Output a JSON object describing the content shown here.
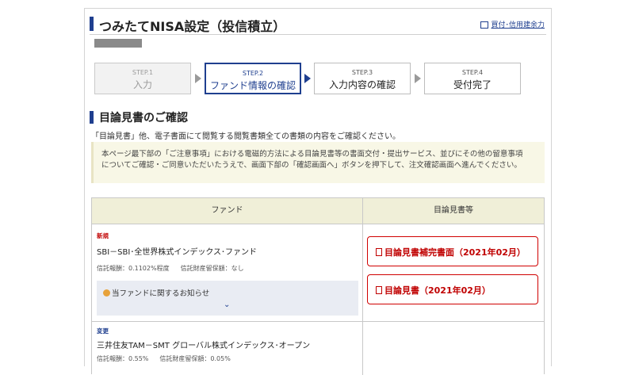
{
  "header": {
    "title": "つみたてNISA設定（投信積立）",
    "link": "買付･信用建余力"
  },
  "steps": [
    {
      "no": "STEP.1",
      "label": "入力",
      "state": "done"
    },
    {
      "no": "STEP.2",
      "label": "ファンド情報の確認",
      "state": "active"
    },
    {
      "no": "STEP.3",
      "label": "入力内容の確認",
      "state": "todo"
    },
    {
      "no": "STEP.4",
      "label": "受付完了",
      "state": "todo"
    }
  ],
  "section": {
    "title": "目論見書のご確認",
    "intro": "「目論見書」他、電子書面にて閲覧する閲覧書類全ての書類の内容をご確認ください。"
  },
  "notice": {
    "line1": "本ページ最下部の「ご注意事項」における電磁的方法による目論見書等の書面交付・提出サービス、並びにその他の留意事項",
    "line2": "についてご確認・ご同意いただいたうえで、画面下部の「確認画面へ」ボタンを押下して、注文確認画面へ進んでください。"
  },
  "table": {
    "col_fund": "ファンド",
    "col_docs": "目論見書等",
    "rows": [
      {
        "badge": "新規",
        "name": "SBI－SBI･全世界株式インデックス･ファンド",
        "fee": "信託報酬：0.1102%程度",
        "reserve": "信託財産留保額：なし",
        "news": "当ファンドに関するお知らせ",
        "news_toggle": "⌄",
        "docs": [
          "目論見書補完書面（2021年02月）",
          "目論見書（2021年02月）"
        ]
      },
      {
        "badge": "変更",
        "name": "三井住友TAM－SMT グローバル株式インデックス･オープン",
        "fee": "信託報酬：0.55%",
        "reserve": "信託財産留保額：0.05%"
      }
    ]
  },
  "colors": {
    "accent": "#1f3f8f",
    "danger": "#c00000",
    "notice_bg": "#f8f7e6",
    "table_header_bg": "#f0efd8"
  }
}
